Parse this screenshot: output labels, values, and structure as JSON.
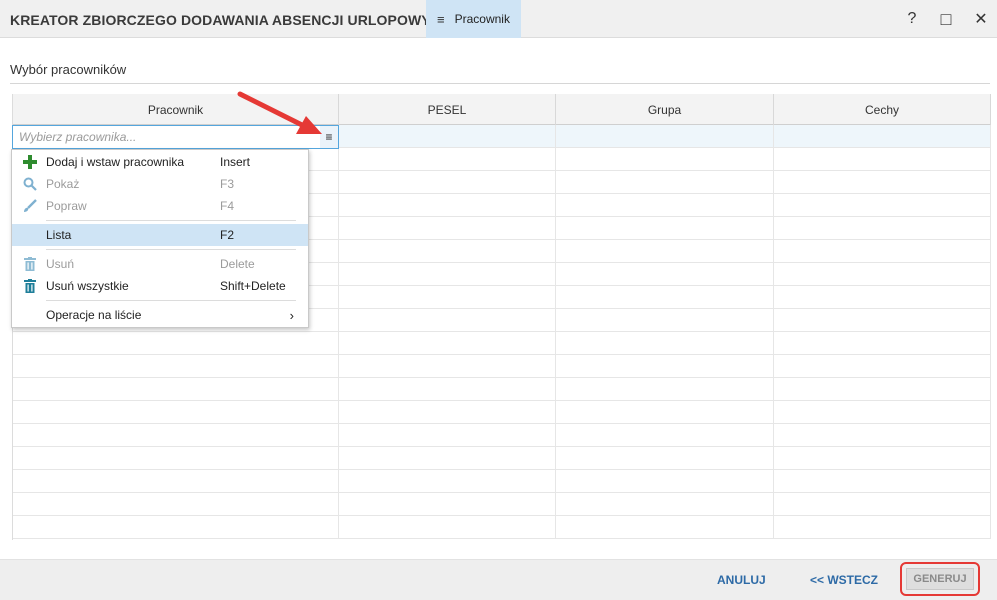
{
  "window": {
    "title": "KREATOR ZBIORCZEGO DODAWANIA ABSENCJI URLOPOWYCH",
    "tab_label": "Pracownik",
    "help_glyph": "?",
    "maximize_glyph": "□",
    "close_glyph": "✕"
  },
  "section": {
    "title": "Wybór pracowników"
  },
  "grid": {
    "columns": [
      "Pracownik",
      "PESEL",
      "Grupa",
      "Cechy"
    ],
    "employee_placeholder": "Wybierz pracownika..."
  },
  "context_menu": {
    "items": [
      {
        "icon": "plus-icon",
        "label": "Dodaj i wstaw pracownika",
        "shortcut": "Insert",
        "enabled": true
      },
      {
        "icon": "magnifier-icon",
        "label": "Pokaż",
        "shortcut": "F3",
        "enabled": false
      },
      {
        "icon": "brush-icon",
        "label": "Popraw",
        "shortcut": "F4",
        "enabled": false
      },
      {
        "icon": "",
        "label": "Lista",
        "shortcut": "F2",
        "enabled": true,
        "highlighted": true
      },
      {
        "icon": "trash-icon",
        "label": "Usuń",
        "shortcut": "Delete",
        "enabled": false
      },
      {
        "icon": "trash-icon",
        "label": "Usuń wszystkie",
        "shortcut": "Shift+Delete",
        "enabled": true
      },
      {
        "icon": "",
        "label": "Operacje na liście",
        "shortcut": "",
        "enabled": true,
        "submenu_glyph": "›"
      }
    ]
  },
  "footer": {
    "cancel_label": "ANULUJ",
    "back_label": "<< WSTECZ",
    "generate_label": "GENERUJ"
  },
  "colors": {
    "accent_blue": "#2d6aa6",
    "highlight": "#cfe4f5",
    "annotation_red": "#e53935",
    "icon_green": "#2e8b2e",
    "icon_teal": "#1f7f9a"
  }
}
